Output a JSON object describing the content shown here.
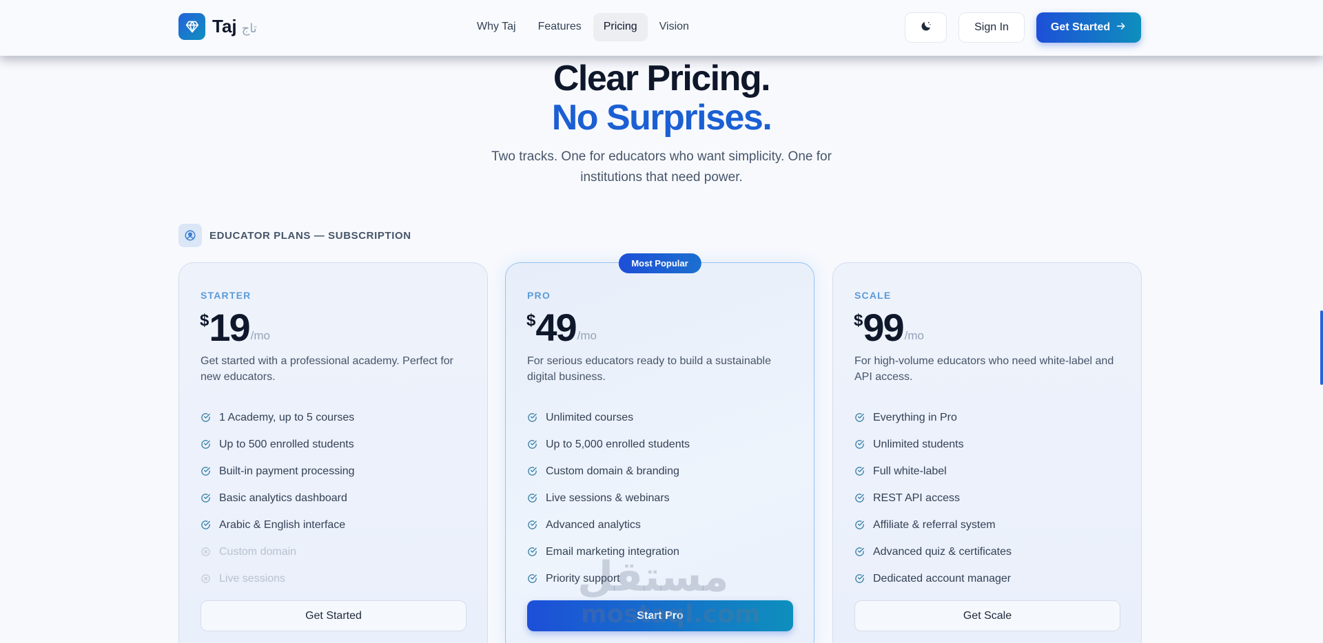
{
  "nav": {
    "brand": "Taj",
    "brand_ar": "تاج",
    "links": [
      "Why Taj",
      "Features",
      "Pricing",
      "Vision"
    ],
    "active_link": "Pricing",
    "signin": "Sign In",
    "get_started": "Get Started"
  },
  "hero": {
    "line1": "Clear Pricing.",
    "line2": "No Surprises.",
    "subtitle": "Two tracks. One for educators who want simplicity. One for institutions that need power."
  },
  "section": {
    "label": "EDUCATOR PLANS — SUBSCRIPTION"
  },
  "plans": [
    {
      "tier": "STARTER",
      "currency": "$",
      "price": "19",
      "period": "/mo",
      "description": "Get started with a professional academy. Perfect for new educators.",
      "features": [
        {
          "text": "1 Academy, up to 5 courses",
          "included": true
        },
        {
          "text": "Up to 500 enrolled students",
          "included": true
        },
        {
          "text": "Built-in payment processing",
          "included": true
        },
        {
          "text": "Basic analytics dashboard",
          "included": true
        },
        {
          "text": "Arabic & English interface",
          "included": true
        },
        {
          "text": "Custom domain",
          "included": false
        },
        {
          "text": "Live sessions",
          "included": false
        }
      ],
      "cta": "Get Started"
    },
    {
      "tier": "PRO",
      "badge": "Most Popular",
      "currency": "$",
      "price": "49",
      "period": "/mo",
      "description": "For serious educators ready to build a sustainable digital business.",
      "features": [
        {
          "text": "Unlimited courses",
          "included": true
        },
        {
          "text": "Up to 5,000 enrolled students",
          "included": true
        },
        {
          "text": "Custom domain & branding",
          "included": true
        },
        {
          "text": "Live sessions & webinars",
          "included": true
        },
        {
          "text": "Advanced analytics",
          "included": true
        },
        {
          "text": "Email marketing integration",
          "included": true
        },
        {
          "text": "Priority support",
          "included": true
        }
      ],
      "cta": "Start Pro"
    },
    {
      "tier": "SCALE",
      "currency": "$",
      "price": "99",
      "period": "/mo",
      "description": "For high-volume educators who need white-label and API access.",
      "features": [
        {
          "text": "Everything in Pro",
          "included": true
        },
        {
          "text": "Unlimited students",
          "included": true
        },
        {
          "text": "Full white-label",
          "included": true
        },
        {
          "text": "REST API access",
          "included": true
        },
        {
          "text": "Affiliate & referral system",
          "included": true
        },
        {
          "text": "Advanced quiz & certificates",
          "included": true
        },
        {
          "text": "Dedicated account manager",
          "included": true
        }
      ],
      "cta": "Get Scale"
    }
  ],
  "watermark": {
    "ar": "مستقل",
    "en": "mostaql.com"
  },
  "colors": {
    "accent": "#1d4fd8",
    "accent_teal": "#0e8fbd",
    "check": "#3b82a6",
    "tier_label": "#5b9bd8"
  }
}
